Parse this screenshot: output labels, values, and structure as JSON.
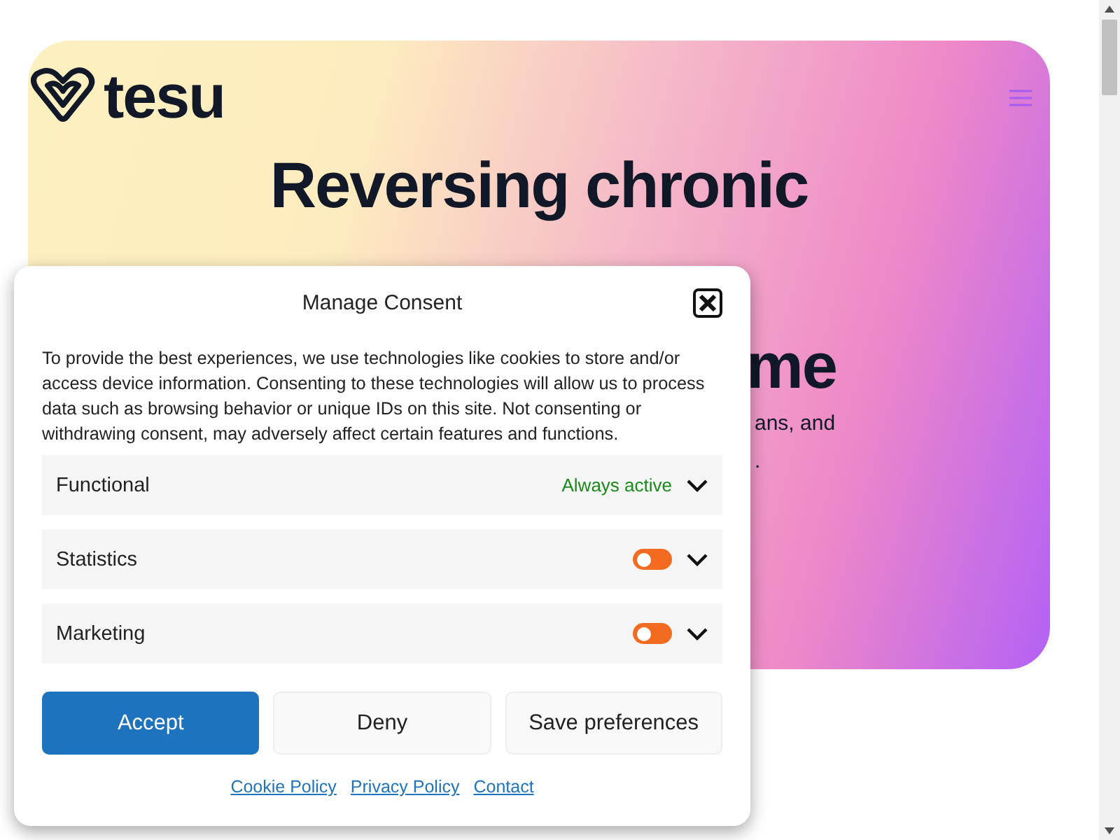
{
  "header": {
    "logo": "tesu"
  },
  "hero": {
    "heading_lines": [
      "Reversing chronic"
    ],
    "fragments": [
      {
        "text": "me",
        "kind": "heading"
      },
      {
        "text": "ans, and",
        "kind": "body"
      },
      {
        "text": ".",
        "kind": "body"
      }
    ]
  },
  "consent": {
    "title": "Manage Consent",
    "description": "To provide the best experiences, we use technologies like cookies to store and/or access device information. Consenting to these technologies will allow us to process data such as browsing behavior or unique IDs on this site. Not consenting or withdrawing consent, may adversely affect certain features and functions.",
    "categories": [
      {
        "name": "Functional",
        "kind": "always",
        "status": "Always active"
      },
      {
        "name": "Statistics",
        "kind": "toggle",
        "checked": false
      },
      {
        "name": "Marketing",
        "kind": "toggle",
        "checked": false
      }
    ],
    "buttons": [
      {
        "label": "Accept",
        "kind": "primary"
      },
      {
        "label": "Deny",
        "kind": "secondary"
      },
      {
        "label": "Save preferences",
        "kind": "secondary"
      }
    ],
    "links": [
      "Cookie Policy",
      "Privacy Policy",
      "Contact"
    ]
  }
}
